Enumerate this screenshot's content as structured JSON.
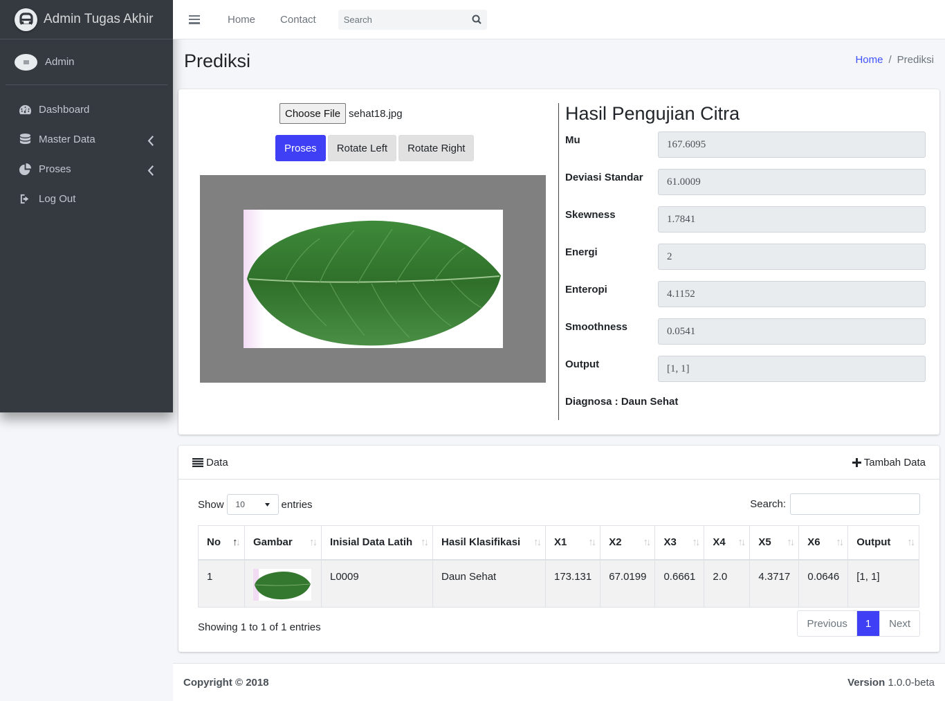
{
  "sidebar": {
    "brand": "Admin Tugas Akhir",
    "user": "Admin",
    "items": [
      {
        "label": "Dashboard",
        "icon": "dashboard-icon"
      },
      {
        "label": "Master Data",
        "icon": "database-icon",
        "has_children": true
      },
      {
        "label": "Proses",
        "icon": "pie-chart-icon",
        "has_children": true
      },
      {
        "label": "Log Out",
        "icon": "sign-out-icon"
      }
    ]
  },
  "header": {
    "links": [
      "Home",
      "Contact"
    ],
    "search_placeholder": "Search"
  },
  "content_header": {
    "title": "Prediksi",
    "breadcrumb": [
      "Home",
      "Prediksi"
    ]
  },
  "prediksi": {
    "choose_file_label": "Choose File",
    "file_name": "sehat18.jpg",
    "buttons": [
      "Proses",
      "Rotate Left",
      "Rotate Right"
    ],
    "result_title": "Hasil Pengujian Citra",
    "fields": [
      {
        "label": "Mu",
        "value": "167.6095"
      },
      {
        "label": "Deviasi Standar",
        "value": "61.0009"
      },
      {
        "label": "Skewness",
        "value": "1.7841"
      },
      {
        "label": "Energi",
        "value": "2"
      },
      {
        "label": "Enteropi",
        "value": "4.1152"
      },
      {
        "label": "Smoothness",
        "value": "0.0541"
      },
      {
        "label": "Output",
        "value": "[1, 1]"
      }
    ],
    "diagnosa": "Diagnosa : Daun Sehat"
  },
  "data_card": {
    "title": "Data",
    "add_label": "Tambah Data",
    "show_label": "Show",
    "entries_label": "entries",
    "page_length": "10",
    "search_label": "Search:",
    "columns": [
      "No",
      "Gambar",
      "Inisial Data Latih",
      "Hasil Klasifikasi",
      "X1",
      "X2",
      "X3",
      "X4",
      "X5",
      "X6",
      "Output"
    ],
    "rows": [
      {
        "no": "1",
        "inisial": "L0009",
        "hasil": "Daun Sehat",
        "x1": "173.131",
        "x2": "67.0199",
        "x3": "0.6661",
        "x4": "2.0",
        "x5": "4.3717",
        "x6": "0.0646",
        "output": "[1, 1]"
      }
    ],
    "info": "Showing 1 to 1 of 1 entries",
    "pagination": {
      "previous": "Previous",
      "current": "1",
      "next": "Next"
    }
  },
  "footer": {
    "copyright": "Copyright © 2018",
    "version_label": "Version",
    "version": "1.0.0-beta"
  },
  "colors": {
    "sidebar_bg": "#343a40",
    "primary": "#3f3ff5",
    "link": "#3f51ff",
    "leaf_green": "#3c7a34"
  }
}
